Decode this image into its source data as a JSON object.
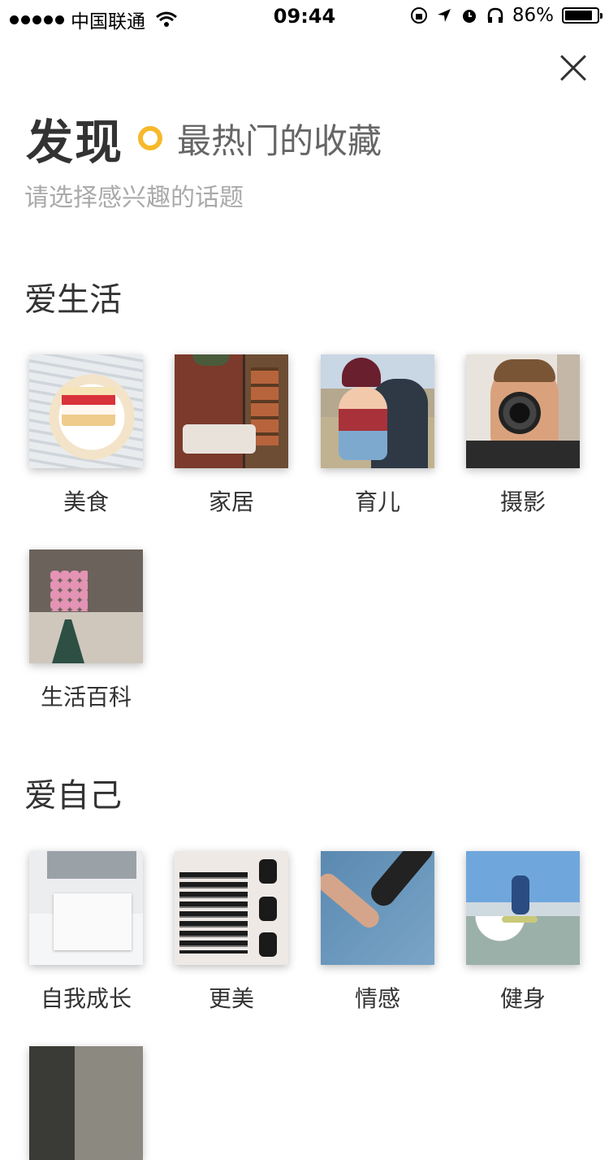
{
  "status_bar": {
    "signal_dots": 5,
    "carrier": "中国联通",
    "time": "09:44",
    "battery_text": "86%",
    "battery_level": 0.86
  },
  "header": {
    "title": "发现",
    "subtitle": "最热门的收藏",
    "prompt": "请选择感兴趣的话题",
    "accent_color": "#f7b92a"
  },
  "sections": [
    {
      "title": "爱生活",
      "items": [
        {
          "label": "美食",
          "icon": "food-photo"
        },
        {
          "label": "家居",
          "icon": "home-photo"
        },
        {
          "label": "育儿",
          "icon": "parenting-photo"
        },
        {
          "label": "摄影",
          "icon": "photography-photo"
        },
        {
          "label": "生活百科",
          "icon": "life-tips-photo"
        }
      ]
    },
    {
      "title": "爱自己",
      "items": [
        {
          "label": "自我成长",
          "icon": "growth-photo"
        },
        {
          "label": "更美",
          "icon": "beauty-photo"
        },
        {
          "label": "情感",
          "icon": "love-photo"
        },
        {
          "label": "健身",
          "icon": "fitness-photo"
        },
        {
          "label": "",
          "icon": "partial-photo"
        }
      ]
    }
  ]
}
